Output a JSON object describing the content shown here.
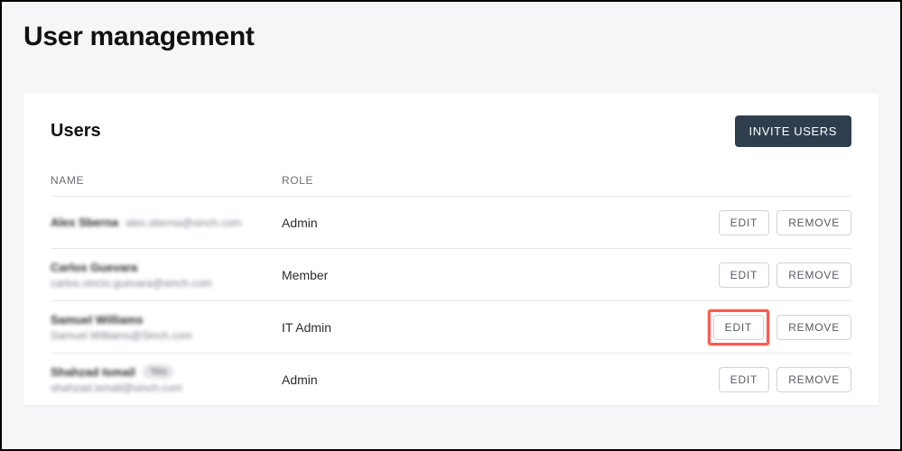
{
  "page_title": "User management",
  "card": {
    "title": "Users",
    "invite_label": "INVITE USERS"
  },
  "table": {
    "headers": {
      "name": "NAME",
      "role": "ROLE"
    },
    "actions": {
      "edit": "EDIT",
      "remove": "REMOVE"
    },
    "rows": [
      {
        "name": "Alex Sberna",
        "email": "alex.sberna@sinch.com",
        "email_inline": true,
        "role": "Admin",
        "you": false,
        "highlight_edit": false
      },
      {
        "name": "Carlos Guevara",
        "email": "carlos.vincio.guevara@sinch.com",
        "email_inline": false,
        "role": "Member",
        "you": false,
        "highlight_edit": false
      },
      {
        "name": "Samuel Williams",
        "email": "Samuel.Williams@Sinch.com",
        "email_inline": false,
        "role": "IT Admin",
        "you": false,
        "highlight_edit": true
      },
      {
        "name": "Shahzad Ismail",
        "email": "shahzad.ismail@sinch.com",
        "email_inline": false,
        "role": "Admin",
        "you": true,
        "highlight_edit": false
      }
    ],
    "you_label": "You"
  },
  "colors": {
    "highlight": "#ff5a4f",
    "primary_btn": "#2f3e4e"
  }
}
